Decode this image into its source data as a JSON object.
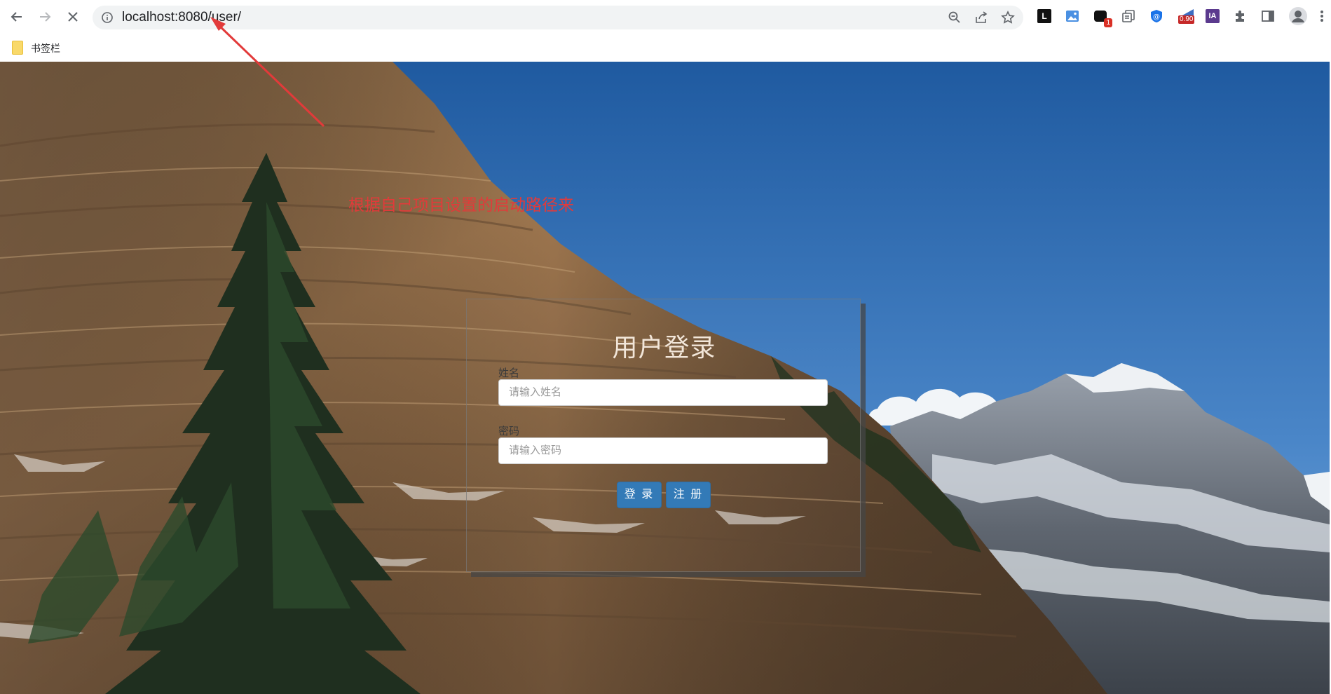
{
  "browser": {
    "url": "localhost:8080/user/",
    "extension_badges": {
      "notifications": "1",
      "rating": "0.90"
    },
    "extension_labels": {
      "reader": "L",
      "translator": "IA"
    },
    "bookmarks_bar": {
      "folder_label": "书签栏"
    }
  },
  "icons": [
    "back-arrow-icon",
    "forward-arrow-icon",
    "stop-loading-icon",
    "site-info-icon",
    "zoom-icon",
    "share-icon",
    "star-icon",
    "extensions-puzzle-icon",
    "side-panel-icon",
    "profile-avatar-icon",
    "kebab-menu-icon",
    "folder-icon"
  ],
  "annotation": {
    "text": "根据自己项目设置的启动路径来",
    "color": "#e23a3a"
  },
  "login": {
    "title": "用户登录",
    "username_label": "姓名",
    "username_placeholder": "请输入姓名",
    "password_label": "密码",
    "password_placeholder": "请输入密码",
    "login_button": "登 录",
    "register_button": "注 册",
    "button_color": "#337ab7"
  }
}
